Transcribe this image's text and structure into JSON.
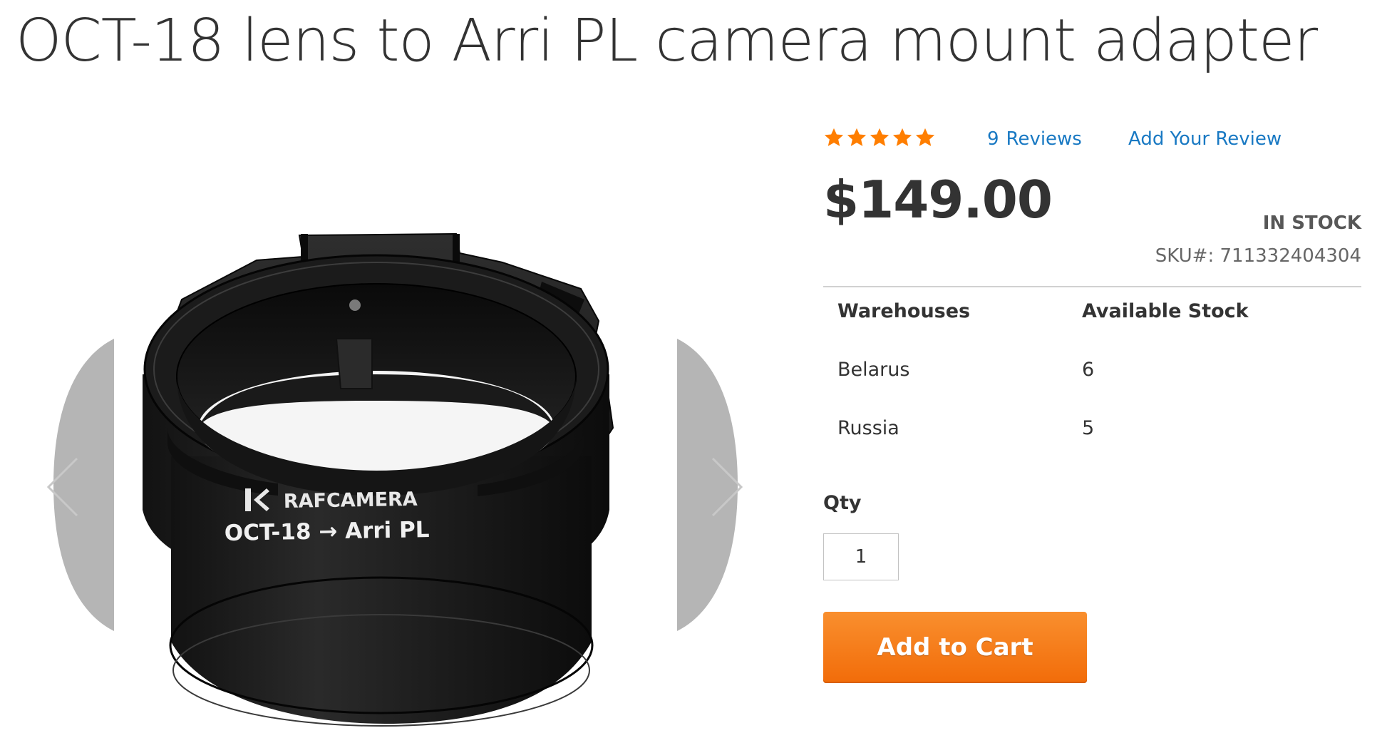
{
  "product": {
    "title": "OCT-18 lens to Arri PL camera mount adapter",
    "image": {
      "brand_text": "RAFCAMERA",
      "engraving_text": "OCT-18 → Arri PL",
      "alt_icon": "camera-lens-adapter-image"
    },
    "gallery": {
      "prev_icon": "chevron-left-icon",
      "next_icon": "chevron-right-icon"
    },
    "rating": {
      "stars": 5,
      "max_stars": 5,
      "star_color": "#ff7e00",
      "reviews_count": "9",
      "reviews_label": "Reviews",
      "add_review_label": "Add Your Review"
    },
    "price": "$149.00",
    "stock_status": "In stock",
    "sku_label": "SKU#:",
    "sku_value": "711332404304",
    "stock_table": {
      "headers": [
        "Warehouses",
        "Available Stock"
      ],
      "rows": [
        [
          "Belarus",
          "6"
        ],
        [
          "Russia",
          "5"
        ]
      ]
    },
    "qty_label": "Qty",
    "qty_value": "1",
    "add_to_cart_label": "Add to Cart"
  },
  "colors": {
    "link": "#1979c3",
    "button": "#f26c09",
    "text": "#333333"
  }
}
